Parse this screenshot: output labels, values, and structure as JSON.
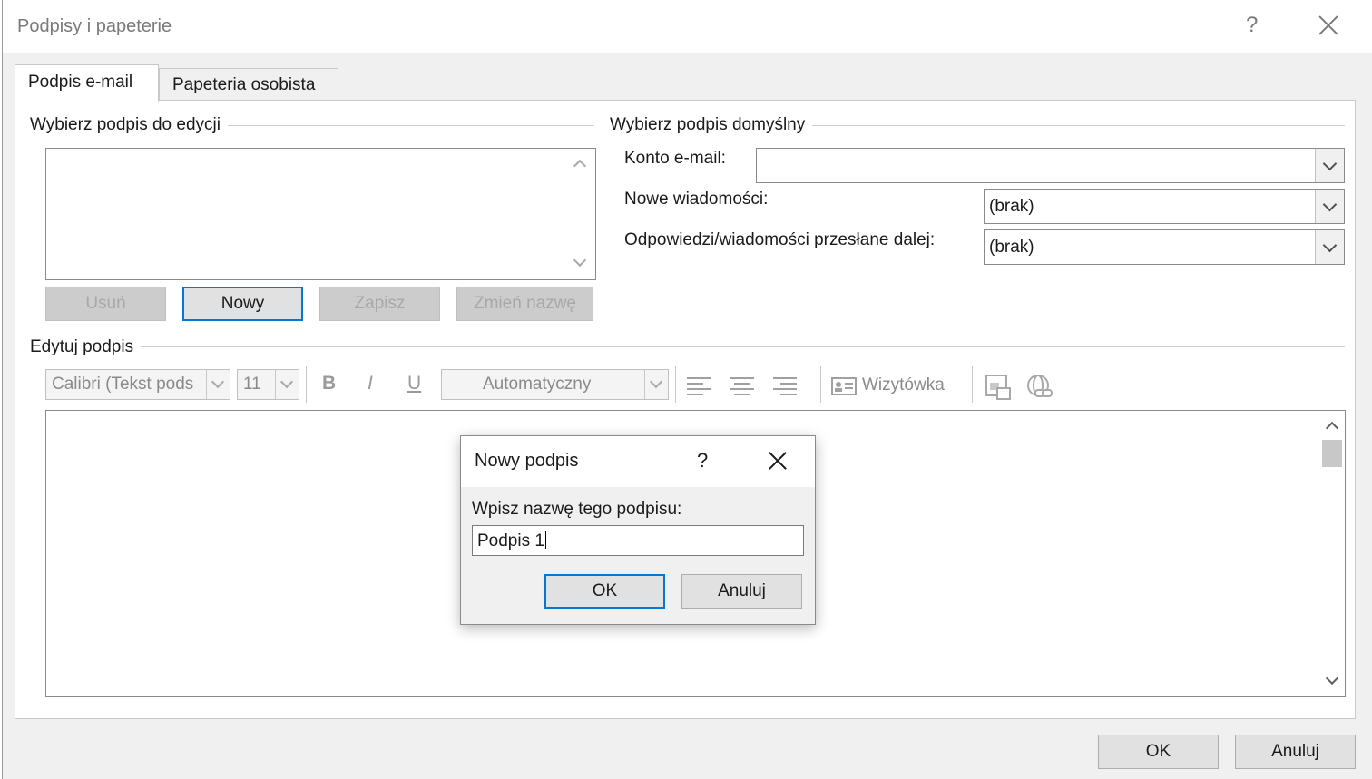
{
  "window": {
    "title": "Podpisy i papeterie",
    "help_glyph": "?"
  },
  "tabs": [
    {
      "label": "Podpis e-mail",
      "active": true
    },
    {
      "label": "Papeteria osobista",
      "active": false
    }
  ],
  "choose_edit": {
    "group_label": "Wybierz podpis do edycji",
    "signatures": [],
    "buttons": {
      "delete": "Usuń",
      "new": "Nowy",
      "save": "Zapisz",
      "rename": "Zmień nazwę"
    }
  },
  "choose_default": {
    "group_label": "Wybierz podpis domyślny",
    "email_account_label": "Konto e-mail:",
    "email_account_value": "",
    "new_messages_label": "Nowe wiadomości:",
    "new_messages_value": "(brak)",
    "replies_label": "Odpowiedzi/wiadomości przesłane dalej:",
    "replies_value": "(brak)"
  },
  "edit_signature": {
    "group_label": "Edytuj podpis",
    "toolbar": {
      "font": "Calibri (Tekst pods",
      "size": "11",
      "bold": "B",
      "italic": "I",
      "underline": "U",
      "color": "Automatyczny",
      "business_card": "Wizytówka"
    },
    "content": ""
  },
  "new_signature_dialog": {
    "title": "Nowy podpis",
    "help_glyph": "?",
    "prompt": "Wpisz nazwę tego podpisu:",
    "input_value": "Podpis 1",
    "ok": "OK",
    "cancel": "Anuluj"
  },
  "footer": {
    "ok": "OK",
    "cancel": "Anuluj"
  },
  "colors": {
    "focus_accent": "#0078d7",
    "window_bg": "#f0f0f0",
    "disabled_text": "#a8a8a8"
  },
  "icons": [
    "close-icon",
    "help-icon",
    "chevron-up-icon",
    "chevron-down-icon",
    "align-left-icon",
    "align-center-icon",
    "align-right-icon",
    "business-card-icon",
    "insert-picture-icon",
    "hyperlink-icon"
  ]
}
